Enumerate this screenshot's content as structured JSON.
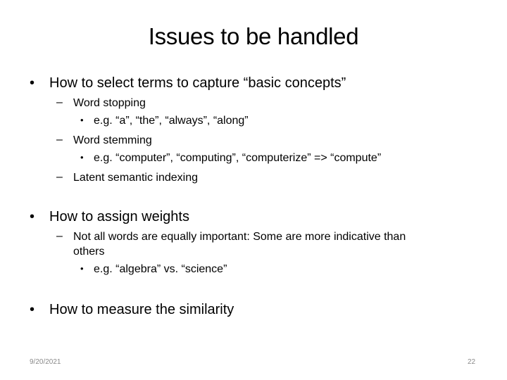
{
  "slide": {
    "title": "Issues to be handled",
    "bullet_char": "•",
    "dash_char": "–",
    "sections": [
      {
        "text": "How to select terms to capture “basic concepts”",
        "items": [
          {
            "text": "Word stopping",
            "sub": "e.g. “a”, “the”, “always”, “along”"
          },
          {
            "text": "Word stemming",
            "sub": "e.g. “computer”, “computing”, “computerize” => “compute”"
          },
          {
            "text": "Latent semantic indexing"
          }
        ]
      },
      {
        "text": "How to assign weights",
        "items": [
          {
            "text_line1": "Not all words are equally important: Some are more indicative than",
            "text_line2": "others",
            "sub": "e.g. “algebra” vs. “science”"
          }
        ]
      },
      {
        "text": "How to measure the similarity"
      }
    ],
    "footer": {
      "date": "9/20/2021",
      "page_number": "22"
    }
  }
}
